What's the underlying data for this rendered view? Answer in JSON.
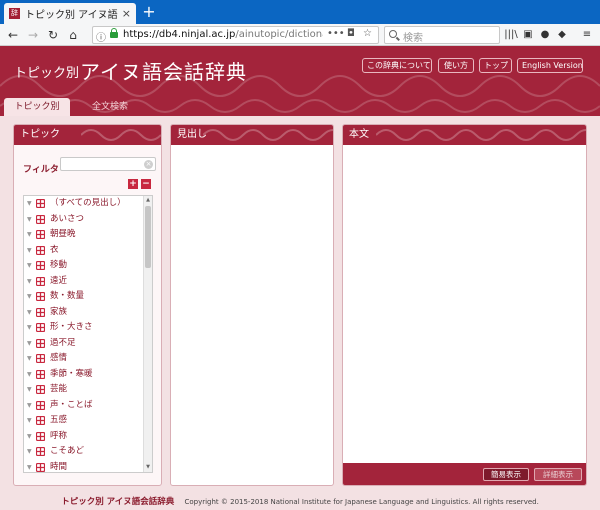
{
  "browser": {
    "tab_title": "トピック別 アイヌ語会話辞典",
    "tab_close": "×",
    "new_tab": "+",
    "url_host": "https://db4.ninjal.ac.jp",
    "url_path": "/ainutopic/dictionary",
    "url_more": "•••",
    "search_placeholder": "検索"
  },
  "header": {
    "subtitle": "トピック別",
    "title": "アイヌ語会話辞典",
    "buttons": [
      "この辞典について",
      "使い方",
      "トップ",
      "English Version"
    ]
  },
  "page_tabs": {
    "active": "トピック別",
    "inactive": "全文検索"
  },
  "topic_panel": {
    "title": "トピック",
    "filter_label": "フィルタ",
    "filter_value": "",
    "expand_label": "+",
    "collapse_label": "−",
    "items": [
      "（すべての見出し）",
      "あいさつ",
      "朝昼晩",
      "衣",
      "移動",
      "遠近",
      "数・数量",
      "家族",
      "形・大きさ",
      "過不足",
      "感情",
      "季節・寒暖",
      "芸能",
      "声・ことば",
      "五感",
      "呼称",
      "こそあど",
      "時間"
    ]
  },
  "headword_panel": {
    "title": "見出し"
  },
  "body_panel": {
    "title": "本文",
    "view_simple": "簡易表示",
    "view_detail": "詳細表示"
  },
  "footer": {
    "brand": "トピック別 アイヌ語会話辞典",
    "copyright": "Copyright © 2015-2018 National Institute for Japanese Language and Linguistics. All rights reserved."
  },
  "colors": {
    "brand": "#a3243b",
    "brand_dark": "#7e1a2c",
    "background": "#f3e1e3"
  }
}
